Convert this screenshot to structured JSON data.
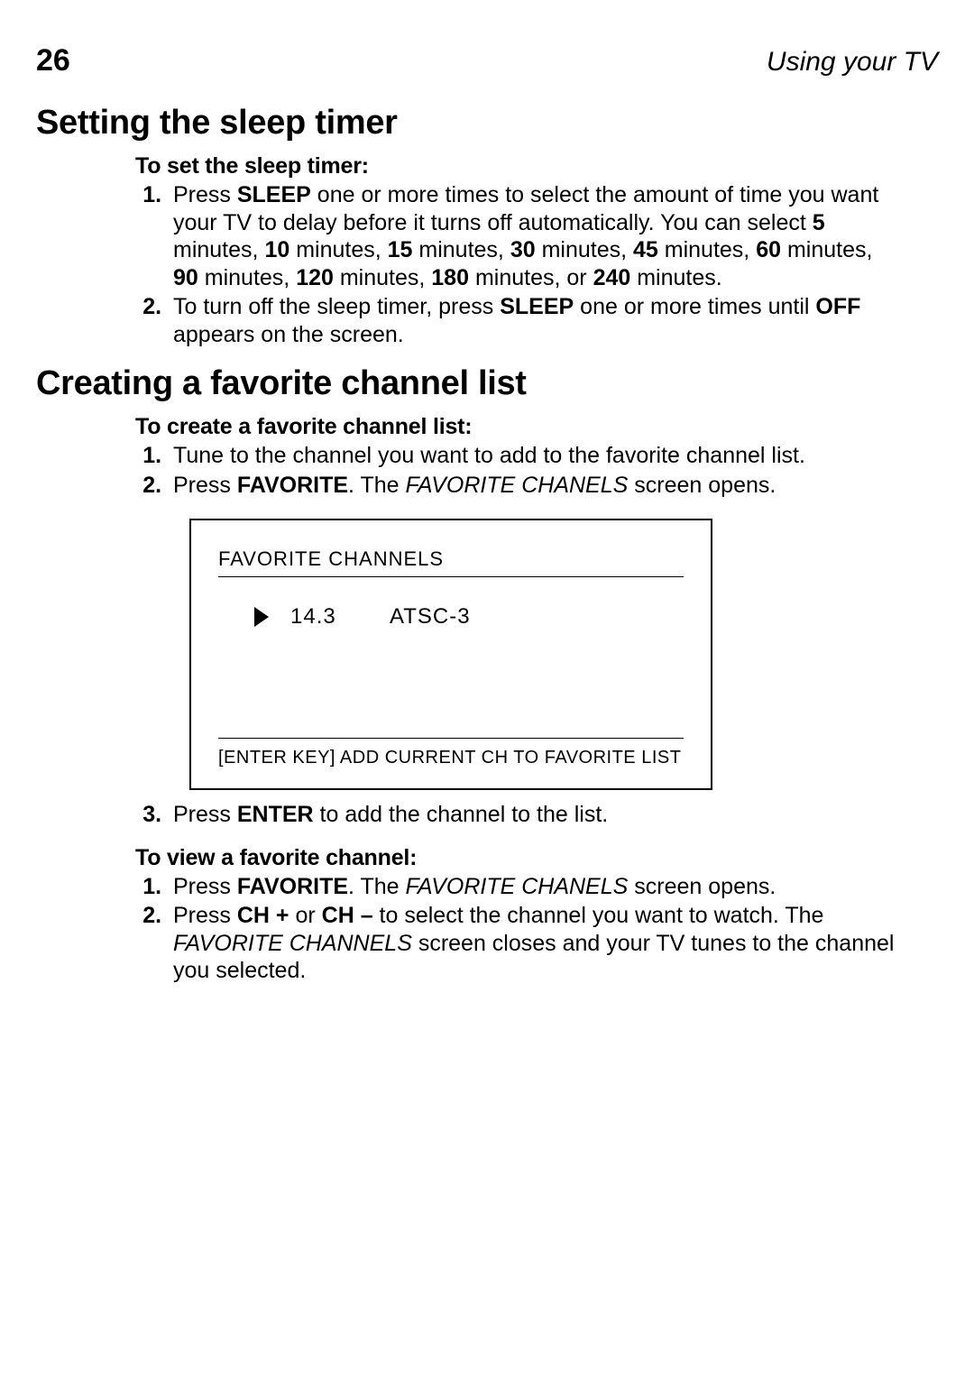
{
  "header": {
    "page_number": "26",
    "running_head": "Using your TV"
  },
  "section1": {
    "title": "Setting the sleep timer",
    "subhead": "To set the sleep timer:",
    "step1_a": "Press ",
    "step1_b": "SLEEP",
    "step1_c": " one or more times to select the amount of time you want your TV to delay before it turns off automatically. You can select ",
    "t5": "5",
    "t5s": " minutes, ",
    "t10": "10",
    "t10s": " minutes, ",
    "t15": "15",
    "t15s": " minutes, ",
    "t30": "30",
    "t30s": " minutes, ",
    "t45": "45",
    "t45s": " minutes, ",
    "t60": "60",
    "t60s": " minutes, ",
    "t90": "90",
    "t90s": " minutes, ",
    "t120": "120",
    "t120s": " minutes, ",
    "t180": "180",
    "t180s": " minutes, or ",
    "t240": "240",
    "t240s": " minutes.",
    "step2_a": "To turn off the sleep timer, press ",
    "step2_b": "SLEEP",
    "step2_c": " one or more times until ",
    "step2_d": "OFF",
    "step2_e": " appears on the screen."
  },
  "section2": {
    "title": "Creating a favorite channel list",
    "create_subhead": "To create a favorite channel list:",
    "c_step1": "Tune to the channel you want to add to the favorite channel list.",
    "c_step2_a": "Press ",
    "c_step2_b": "FAVORITE",
    "c_step2_c": ". The ",
    "c_step2_d": "FAVORITE CHANELS",
    "c_step2_e": " screen opens.",
    "c_step3_a": "Press ",
    "c_step3_b": "ENTER",
    "c_step3_c": " to add the channel to the list.",
    "view_subhead": "To view a favorite channel:",
    "v_step1_a": "Press ",
    "v_step1_b": "FAVORITE",
    "v_step1_c": ". The ",
    "v_step1_d": "FAVORITE CHANELS",
    "v_step1_e": " screen opens.",
    "v_step2_a": "Press ",
    "v_step2_b": "CH +",
    "v_step2_c": " or ",
    "v_step2_d": "CH –",
    "v_step2_e": " to select the channel you want to watch. The ",
    "v_step2_f": "FAVORITE CHANNELS",
    "v_step2_g": " screen closes and your TV tunes to the channel you selected."
  },
  "screen": {
    "title": "FAVORITE CHANNELS",
    "ch_num": "14.3",
    "ch_name": "ATSC-3",
    "footer": "[ENTER KEY] ADD CURRENT CH TO FAVORITE LIST"
  }
}
